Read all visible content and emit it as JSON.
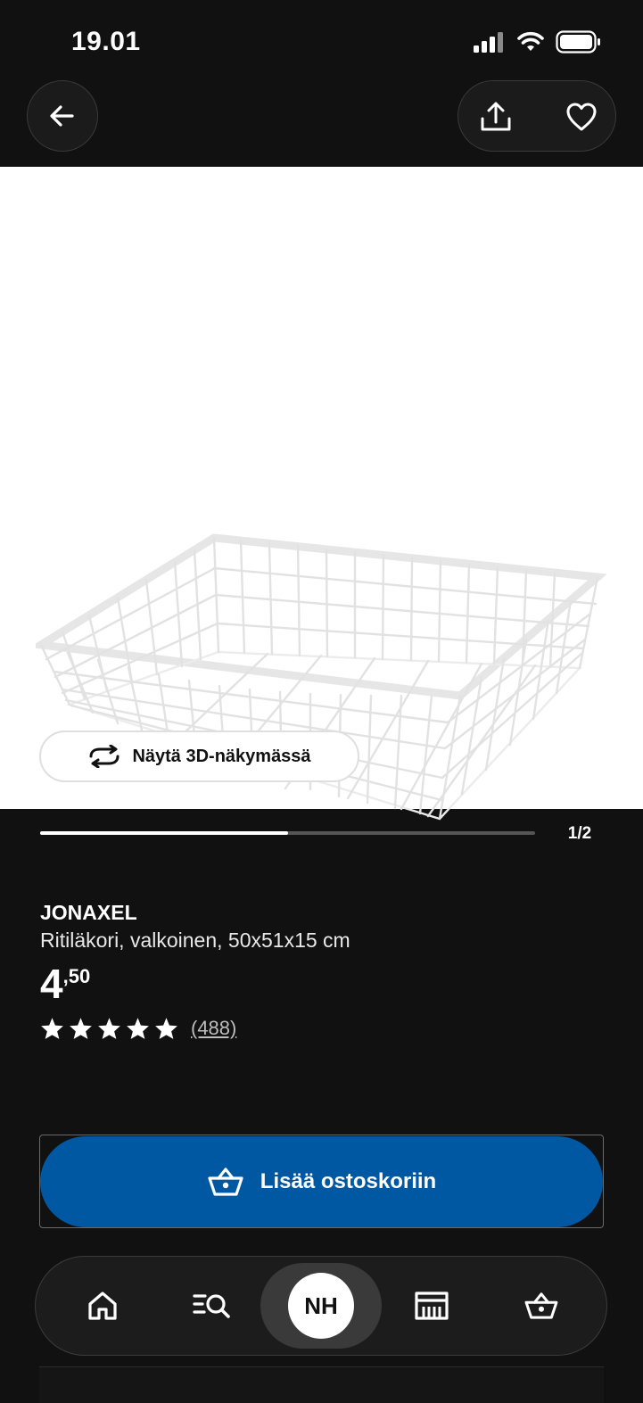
{
  "status_bar": {
    "time": "19.01"
  },
  "header": {
    "back_icon": "arrow-left-icon",
    "share_icon": "share-icon",
    "favorite_icon": "heart-icon"
  },
  "gallery": {
    "image_alt_icon": "wire-basket-product-image",
    "view_3d_label": "Näytä 3D-näkymässä",
    "page_counter": "1/2",
    "progress": 0.5
  },
  "product": {
    "name": "JONAXEL",
    "description": "Ritiläkori, valkoinen, 50x51x15 cm",
    "price_integer": "4",
    "price_decimal": ",50",
    "rating_stars": 5,
    "review_count": "(488)"
  },
  "cart": {
    "label": "Lisää ostoskoriin",
    "icon": "basket-icon"
  },
  "nav": {
    "items": [
      {
        "name": "home",
        "icon": "home-icon"
      },
      {
        "name": "search",
        "icon": "search-list-icon"
      },
      {
        "name": "profile",
        "initials": "NH"
      },
      {
        "name": "store",
        "icon": "store-icon"
      },
      {
        "name": "cart",
        "icon": "basket-icon"
      }
    ]
  },
  "colors": {
    "background": "#111111",
    "accent": "#0058a3",
    "gallery_bg": "#ffffff"
  }
}
